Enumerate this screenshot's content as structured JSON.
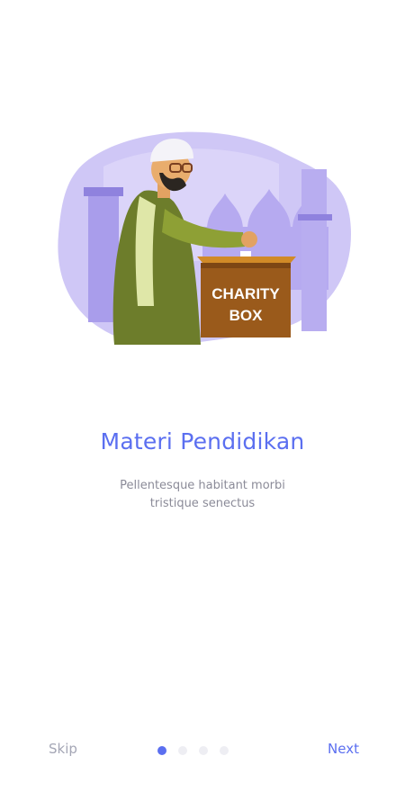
{
  "onboarding": {
    "illustration": {
      "box_text_line1": "CHARITY",
      "box_text_line2": "BOX"
    },
    "title": "Materi Pendidikan",
    "subtitle_line1": "Pellentesque habitant morbi",
    "subtitle_line2": "tristique senectus",
    "skip_label": "Skip",
    "next_label": "Next",
    "page_indicator": {
      "total": 4,
      "current": 1
    }
  },
  "colors": {
    "accent": "#5b6ff0",
    "muted_text": "#8b8b98",
    "inactive_dot": "#eeeef3",
    "blob": "#c8c0f4"
  }
}
